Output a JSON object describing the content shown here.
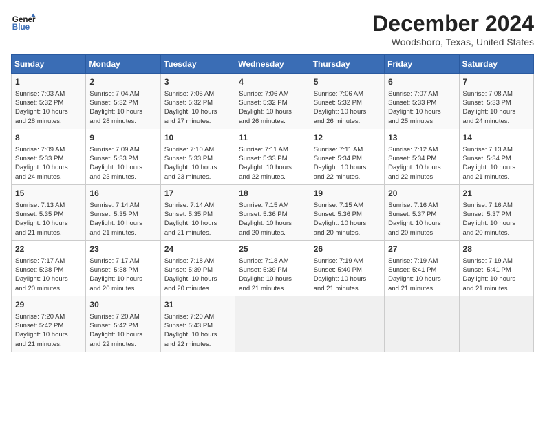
{
  "header": {
    "logo_line1": "General",
    "logo_line2": "Blue",
    "month": "December 2024",
    "location": "Woodsboro, Texas, United States"
  },
  "weekdays": [
    "Sunday",
    "Monday",
    "Tuesday",
    "Wednesday",
    "Thursday",
    "Friday",
    "Saturday"
  ],
  "weeks": [
    [
      {
        "day": "1",
        "content": "Sunrise: 7:03 AM\nSunset: 5:32 PM\nDaylight: 10 hours\nand 28 minutes."
      },
      {
        "day": "2",
        "content": "Sunrise: 7:04 AM\nSunset: 5:32 PM\nDaylight: 10 hours\nand 28 minutes."
      },
      {
        "day": "3",
        "content": "Sunrise: 7:05 AM\nSunset: 5:32 PM\nDaylight: 10 hours\nand 27 minutes."
      },
      {
        "day": "4",
        "content": "Sunrise: 7:06 AM\nSunset: 5:32 PM\nDaylight: 10 hours\nand 26 minutes."
      },
      {
        "day": "5",
        "content": "Sunrise: 7:06 AM\nSunset: 5:32 PM\nDaylight: 10 hours\nand 26 minutes."
      },
      {
        "day": "6",
        "content": "Sunrise: 7:07 AM\nSunset: 5:33 PM\nDaylight: 10 hours\nand 25 minutes."
      },
      {
        "day": "7",
        "content": "Sunrise: 7:08 AM\nSunset: 5:33 PM\nDaylight: 10 hours\nand 24 minutes."
      }
    ],
    [
      {
        "day": "8",
        "content": "Sunrise: 7:09 AM\nSunset: 5:33 PM\nDaylight: 10 hours\nand 24 minutes."
      },
      {
        "day": "9",
        "content": "Sunrise: 7:09 AM\nSunset: 5:33 PM\nDaylight: 10 hours\nand 23 minutes."
      },
      {
        "day": "10",
        "content": "Sunrise: 7:10 AM\nSunset: 5:33 PM\nDaylight: 10 hours\nand 23 minutes."
      },
      {
        "day": "11",
        "content": "Sunrise: 7:11 AM\nSunset: 5:33 PM\nDaylight: 10 hours\nand 22 minutes."
      },
      {
        "day": "12",
        "content": "Sunrise: 7:11 AM\nSunset: 5:34 PM\nDaylight: 10 hours\nand 22 minutes."
      },
      {
        "day": "13",
        "content": "Sunrise: 7:12 AM\nSunset: 5:34 PM\nDaylight: 10 hours\nand 22 minutes."
      },
      {
        "day": "14",
        "content": "Sunrise: 7:13 AM\nSunset: 5:34 PM\nDaylight: 10 hours\nand 21 minutes."
      }
    ],
    [
      {
        "day": "15",
        "content": "Sunrise: 7:13 AM\nSunset: 5:35 PM\nDaylight: 10 hours\nand 21 minutes."
      },
      {
        "day": "16",
        "content": "Sunrise: 7:14 AM\nSunset: 5:35 PM\nDaylight: 10 hours\nand 21 minutes."
      },
      {
        "day": "17",
        "content": "Sunrise: 7:14 AM\nSunset: 5:35 PM\nDaylight: 10 hours\nand 21 minutes."
      },
      {
        "day": "18",
        "content": "Sunrise: 7:15 AM\nSunset: 5:36 PM\nDaylight: 10 hours\nand 20 minutes."
      },
      {
        "day": "19",
        "content": "Sunrise: 7:15 AM\nSunset: 5:36 PM\nDaylight: 10 hours\nand 20 minutes."
      },
      {
        "day": "20",
        "content": "Sunrise: 7:16 AM\nSunset: 5:37 PM\nDaylight: 10 hours\nand 20 minutes."
      },
      {
        "day": "21",
        "content": "Sunrise: 7:16 AM\nSunset: 5:37 PM\nDaylight: 10 hours\nand 20 minutes."
      }
    ],
    [
      {
        "day": "22",
        "content": "Sunrise: 7:17 AM\nSunset: 5:38 PM\nDaylight: 10 hours\nand 20 minutes."
      },
      {
        "day": "23",
        "content": "Sunrise: 7:17 AM\nSunset: 5:38 PM\nDaylight: 10 hours\nand 20 minutes."
      },
      {
        "day": "24",
        "content": "Sunrise: 7:18 AM\nSunset: 5:39 PM\nDaylight: 10 hours\nand 20 minutes."
      },
      {
        "day": "25",
        "content": "Sunrise: 7:18 AM\nSunset: 5:39 PM\nDaylight: 10 hours\nand 21 minutes."
      },
      {
        "day": "26",
        "content": "Sunrise: 7:19 AM\nSunset: 5:40 PM\nDaylight: 10 hours\nand 21 minutes."
      },
      {
        "day": "27",
        "content": "Sunrise: 7:19 AM\nSunset: 5:41 PM\nDaylight: 10 hours\nand 21 minutes."
      },
      {
        "day": "28",
        "content": "Sunrise: 7:19 AM\nSunset: 5:41 PM\nDaylight: 10 hours\nand 21 minutes."
      }
    ],
    [
      {
        "day": "29",
        "content": "Sunrise: 7:20 AM\nSunset: 5:42 PM\nDaylight: 10 hours\nand 21 minutes."
      },
      {
        "day": "30",
        "content": "Sunrise: 7:20 AM\nSunset: 5:42 PM\nDaylight: 10 hours\nand 22 minutes."
      },
      {
        "day": "31",
        "content": "Sunrise: 7:20 AM\nSunset: 5:43 PM\nDaylight: 10 hours\nand 22 minutes."
      },
      {
        "day": "",
        "content": ""
      },
      {
        "day": "",
        "content": ""
      },
      {
        "day": "",
        "content": ""
      },
      {
        "day": "",
        "content": ""
      }
    ]
  ]
}
